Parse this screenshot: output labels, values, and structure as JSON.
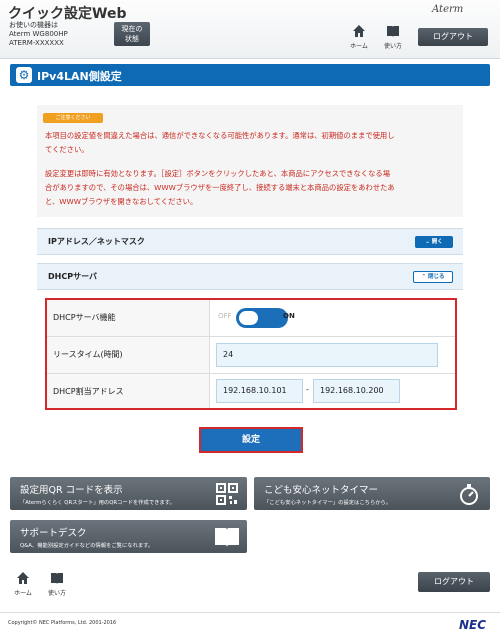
{
  "header": {
    "app_title": "クイック設定Web",
    "device_line1": "お使いの機器は",
    "device_line2": "Aterm WG800HP",
    "device_line3": "ATERM-XXXXXX",
    "status_button_line1": "現在の",
    "status_button_line2": "状態",
    "brand": "Aterm",
    "home_label": "ホーム",
    "help_label": "使い方",
    "logout_label": "ログアウト"
  },
  "page": {
    "title": "IPv4LAN側設定"
  },
  "notice": {
    "badge": "ご注意ください",
    "lines": [
      "本項目の設定値を間違えた場合は、通信ができなくなる可能性があります。通常は、初期値のままで使用し",
      "てください。",
      "設定変更は即時に有効となります。［設定］ボタンをクリックしたあと、本商品にアクセスできなくなる場",
      "合がありますので、その場合は、WWWブラウザを一度終了し、接続する端末と本商品の設定をあわせたあ",
      "と、WWWブラウザを開きなおしてください。"
    ]
  },
  "sections": {
    "ip_title": "IPアドレス／ネットマスク",
    "ip_button": "開く",
    "dhcp_title": "DHCPサーバ",
    "dhcp_button": "閉じる"
  },
  "form": {
    "dhcp_function_label": "DHCPサーバ機能",
    "toggle_off": "OFF",
    "toggle_on": "ON",
    "dhcp_enabled": true,
    "lease_label": "リースタイム(時間)",
    "lease_value": "24",
    "range_label": "DHCP割当アドレス",
    "range_start": "192.168.10.101",
    "range_separator": "-",
    "range_end": "192.168.10.200",
    "submit_label": "設定"
  },
  "tiles": {
    "qr_title": "設定用QR コードを表示",
    "qr_sub": "「Atermらくらく QRスタート」用のQRコードを作成できます。",
    "kids_title": "こども安心ネットタイマー",
    "kids_sub": "「こども安心ネットタイマー」の設定はこちらから。",
    "support_title": "サポートデスク",
    "support_sub": "Q&A、機能別設定ガイドなどの情報をご覧になれます。"
  },
  "footer": {
    "home_label": "ホーム",
    "help_label": "使い方",
    "logout_label": "ログアウト",
    "copyright": "Copyright© NEC Platforms, Ltd. 2001-2016",
    "nec": "NEC"
  },
  "colors": {
    "primary": "#0e6ab5",
    "warning_text": "#c8281e",
    "highlight_border": "#d4282a",
    "tile_bg": "#5a636b"
  }
}
